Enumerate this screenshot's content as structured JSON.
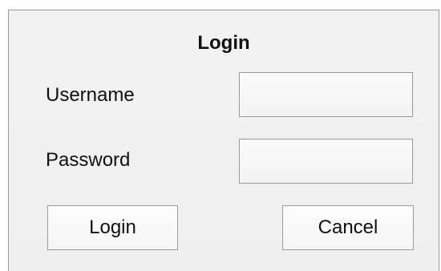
{
  "dialog": {
    "title": "Login",
    "username": {
      "label": "Username",
      "value": "",
      "placeholder": ""
    },
    "password": {
      "label": "Password",
      "value": "",
      "placeholder": ""
    },
    "buttons": {
      "login_label": "Login",
      "cancel_label": "Cancel"
    }
  },
  "colors": {
    "dialog_background": "#f0f0f0",
    "border": "#9a9a9a",
    "text": "#111111"
  }
}
